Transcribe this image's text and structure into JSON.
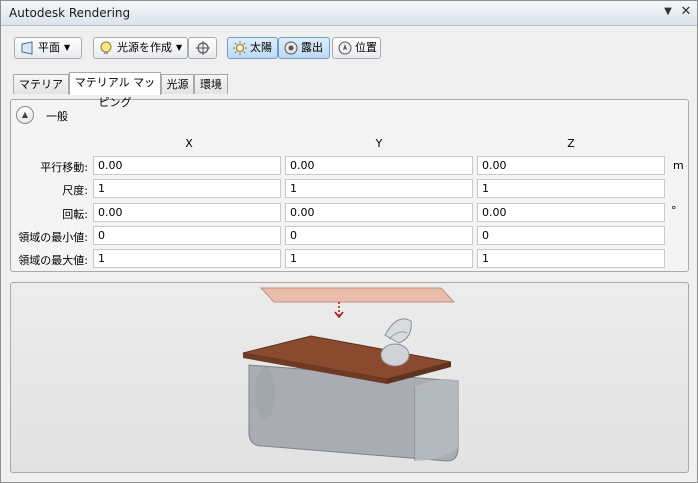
{
  "window": {
    "title": "Autodesk Rendering"
  },
  "toolbar": {
    "plane_label": "平面",
    "create_light_label": "光源を作成",
    "sun_label": "太陽",
    "exposure_label": "露出",
    "location_label": "位置"
  },
  "tabs": [
    {
      "label": "マテリアル"
    },
    {
      "label": "マテリアル マッピング",
      "active": true
    },
    {
      "label": "光源"
    },
    {
      "label": "環境"
    }
  ],
  "section": {
    "title": "一般"
  },
  "grid": {
    "columns": [
      "X",
      "Y",
      "Z"
    ],
    "rows": [
      {
        "label": "平行移動:",
        "values": [
          "0.00",
          "0.00",
          "0.00"
        ],
        "unit": "m"
      },
      {
        "label": "尺度:",
        "values": [
          "1",
          "1",
          "1"
        ],
        "unit": ""
      },
      {
        "label": "回転:",
        "values": [
          "0.00",
          "0.00",
          "0.00"
        ],
        "unit": "°"
      },
      {
        "label": "領域の最小値:",
        "values": [
          "0",
          "0",
          "0"
        ],
        "unit": ""
      },
      {
        "label": "領域の最大値:",
        "values": [
          "1",
          "1",
          "1"
        ],
        "unit": ""
      }
    ]
  },
  "colors": {
    "wood": "#8a4a2e",
    "projection_plane": "#e9b8a6",
    "body_gray": "#a9adb3"
  }
}
